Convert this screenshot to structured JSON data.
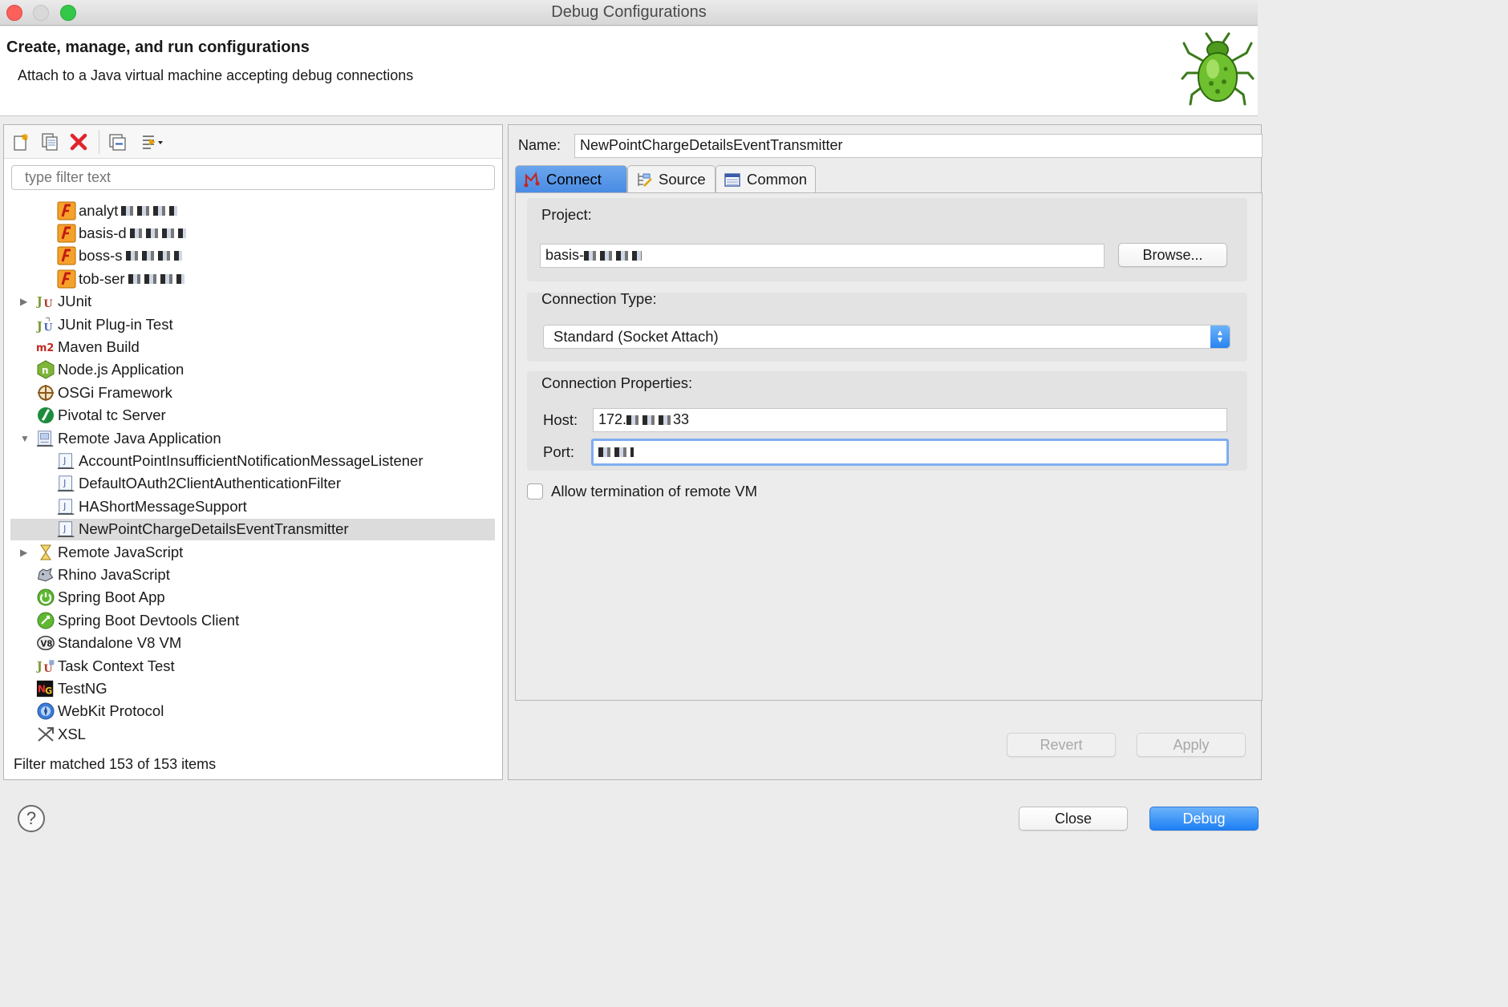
{
  "window": {
    "title": "Debug Configurations"
  },
  "banner": {
    "title": "Create, manage, and run configurations",
    "subtitle": "Attach to a Java virtual machine accepting debug connections"
  },
  "filter": {
    "placeholder": "type filter text"
  },
  "tree": {
    "items": [
      {
        "label": "analyt",
        "icon": "java-app-icon",
        "indent": 2,
        "redacted": true
      },
      {
        "label": "basis-d",
        "icon": "java-app-icon",
        "indent": 2,
        "redacted": true
      },
      {
        "label": "boss-s",
        "icon": "java-app-icon",
        "indent": 2,
        "redacted": true
      },
      {
        "label": "tob-ser",
        "icon": "java-app-icon",
        "indent": 2,
        "redacted": true
      },
      {
        "label": "JUnit",
        "icon": "junit-icon",
        "indent": 1,
        "twisty": "collapsed"
      },
      {
        "label": "JUnit Plug-in Test",
        "icon": "junit-plugin-icon",
        "indent": 1
      },
      {
        "label": "Maven Build",
        "icon": "maven-icon",
        "indent": 1
      },
      {
        "label": "Node.js Application",
        "icon": "nodejs-icon",
        "indent": 1
      },
      {
        "label": "OSGi Framework",
        "icon": "osgi-icon",
        "indent": 1
      },
      {
        "label": "Pivotal tc Server",
        "icon": "pivotal-icon",
        "indent": 1
      },
      {
        "label": "Remote Java Application",
        "icon": "remote-java-icon",
        "indent": 1,
        "twisty": "expanded"
      },
      {
        "label": "AccountPointInsufficientNotificationMessageListener",
        "icon": "remote-java-config-icon",
        "indent": 2
      },
      {
        "label": "DefaultOAuth2ClientAuthenticationFilter",
        "icon": "remote-java-config-icon",
        "indent": 2
      },
      {
        "label": "HAShortMessageSupport",
        "icon": "remote-java-config-icon",
        "indent": 2
      },
      {
        "label": "NewPointChargeDetailsEventTransmitter",
        "icon": "remote-java-config-icon",
        "indent": 2,
        "selected": true
      },
      {
        "label": "Remote JavaScript",
        "icon": "remote-javascript-icon",
        "indent": 1,
        "twisty": "collapsed"
      },
      {
        "label": "Rhino JavaScript",
        "icon": "rhino-icon",
        "indent": 1
      },
      {
        "label": "Spring Boot App",
        "icon": "spring-boot-icon",
        "indent": 1
      },
      {
        "label": "Spring Boot Devtools Client",
        "icon": "spring-devtools-icon",
        "indent": 1
      },
      {
        "label": "Standalone V8 VM",
        "icon": "v8-icon",
        "indent": 1
      },
      {
        "label": "Task Context Test",
        "icon": "task-context-icon",
        "indent": 1
      },
      {
        "label": "TestNG",
        "icon": "testng-icon",
        "indent": 1
      },
      {
        "label": "WebKit Protocol",
        "icon": "webkit-icon",
        "indent": 1
      },
      {
        "label": "XSL",
        "icon": "xsl-icon",
        "indent": 1
      }
    ],
    "status": "Filter matched 153 of 153 items"
  },
  "config": {
    "name_label": "Name:",
    "name": "NewPointChargeDetailsEventTransmitter",
    "tabs": [
      {
        "label": "Connect",
        "icon": "connect-icon",
        "active": true
      },
      {
        "label": "Source",
        "icon": "source-icon"
      },
      {
        "label": "Common",
        "icon": "common-icon"
      }
    ],
    "project_label": "Project:",
    "project": "basis-",
    "browse": "Browse...",
    "connection_type_label": "Connection Type:",
    "connection_type": "Standard (Socket Attach)",
    "connection_properties_label": "Connection Properties:",
    "host_label": "Host:",
    "host": "172.",
    "host_suffix": "33",
    "port_label": "Port:",
    "allow_termination": "Allow termination of remote VM",
    "allow_termination_checked": false,
    "revert": "Revert",
    "apply": "Apply"
  },
  "footer": {
    "help": "?",
    "close": "Close",
    "debug": "Debug"
  },
  "colors": {
    "accent": "#1d7ff4",
    "selection": "#dcdcdc",
    "delete": "#e0242a"
  }
}
